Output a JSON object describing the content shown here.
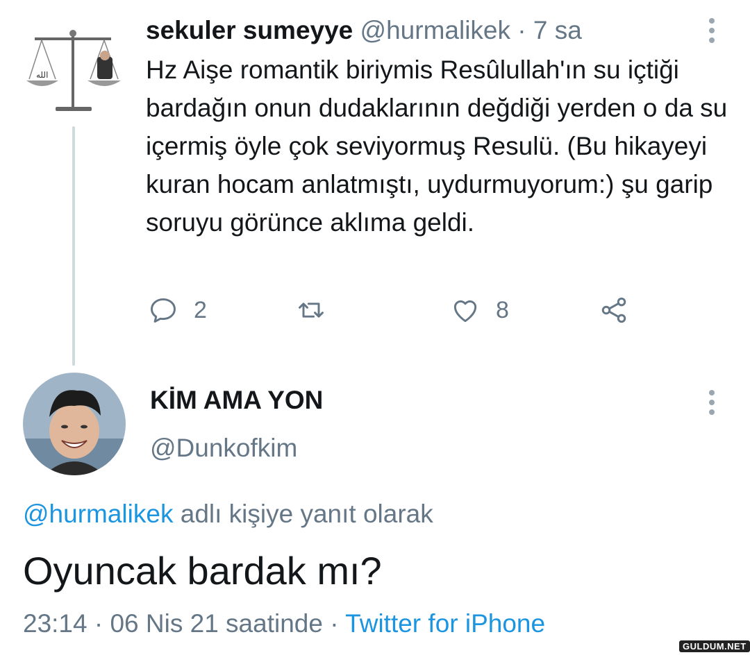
{
  "parent_tweet": {
    "display_name": "sekuler sumeyye",
    "handle": "@hurmalikek",
    "separator": "·",
    "time": "7 sa",
    "text": "Hz Aişe romantik biriymis Resûlullah'ın su içtiği bardağın onun dudaklarının değdiği yerden o da su içermiş öyle çok seviyormuş Resulü. (Bu hikayeyi kuran hocam anlatmıştı, uydurmuyorum:) şu garip soruyu görünce aklıma geldi.",
    "avatar_icon": "scale-avatar",
    "actions": {
      "reply_count": "2",
      "retweet_count": "",
      "like_count": "8"
    }
  },
  "reply_tweet": {
    "display_name": "KİM AMA YON",
    "handle": "@Dunkofkim",
    "avatar_icon": "person-avatar",
    "reply_context_mention": "@hurmalikek",
    "reply_context_text": " adlı kişiye yanıt olarak",
    "text": "Oyuncak bardak mı?",
    "time": "23:14 · 06 Nis 21 saatinde · ",
    "source": "Twitter for iPhone"
  },
  "watermark": "GULDUM.NET",
  "colors": {
    "text": "#14171a",
    "secondary": "#657786",
    "link": "#1b95e0",
    "thread_line": "#cfd9de"
  }
}
